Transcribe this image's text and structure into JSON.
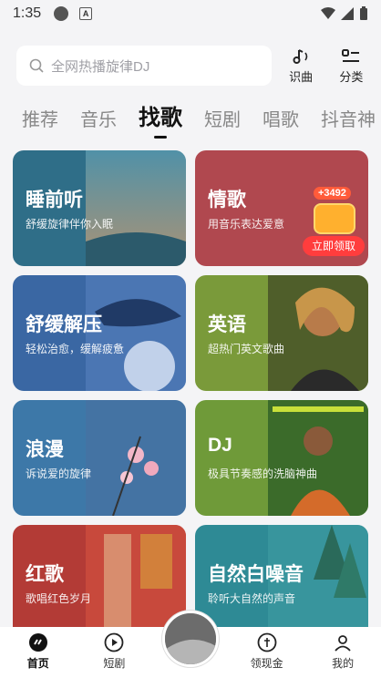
{
  "status_bar": {
    "time": "1:35",
    "badge": "A"
  },
  "search": {
    "placeholder": "全网热播旋律DJ"
  },
  "top_actions": {
    "recognize_label": "识曲",
    "category_label": "分类"
  },
  "tabs": [
    {
      "label": "推荐",
      "active": false
    },
    {
      "label": "音乐",
      "active": false
    },
    {
      "label": "找歌",
      "active": true
    },
    {
      "label": "短剧",
      "active": false
    },
    {
      "label": "唱歌",
      "active": false
    },
    {
      "label": "抖音神",
      "active": false
    }
  ],
  "cards": [
    {
      "title": "睡前听",
      "sub": "舒缓旋律伴你入眠",
      "color": "#2f6e88"
    },
    {
      "title": "情歌",
      "sub": "用音乐表达爱意",
      "color": "#b0484f"
    },
    {
      "title": "舒缓解压",
      "sub": "轻松治愈，缓解疲惫",
      "color": "#3a67a3"
    },
    {
      "title": "英语",
      "sub": "超热门英文歌曲",
      "color": "#7a9a3a"
    },
    {
      "title": "浪漫",
      "sub": "诉说爱的旋律",
      "color": "#3d78a8"
    },
    {
      "title": "DJ",
      "sub": "极具节奏感的洗脑神曲",
      "color": "#6f9a39"
    },
    {
      "title": "红歌",
      "sub": "歌唱红色岁月",
      "color": "#b33b36"
    },
    {
      "title": "自然白噪音",
      "sub": "聆听大自然的声音",
      "color": "#2e8a95"
    }
  ],
  "promo": {
    "amount": "+3492",
    "button": "立即领取"
  },
  "bottom_nav": {
    "home": "首页",
    "short_drama": "短剧",
    "earn": "领现金",
    "mine": "我的"
  }
}
